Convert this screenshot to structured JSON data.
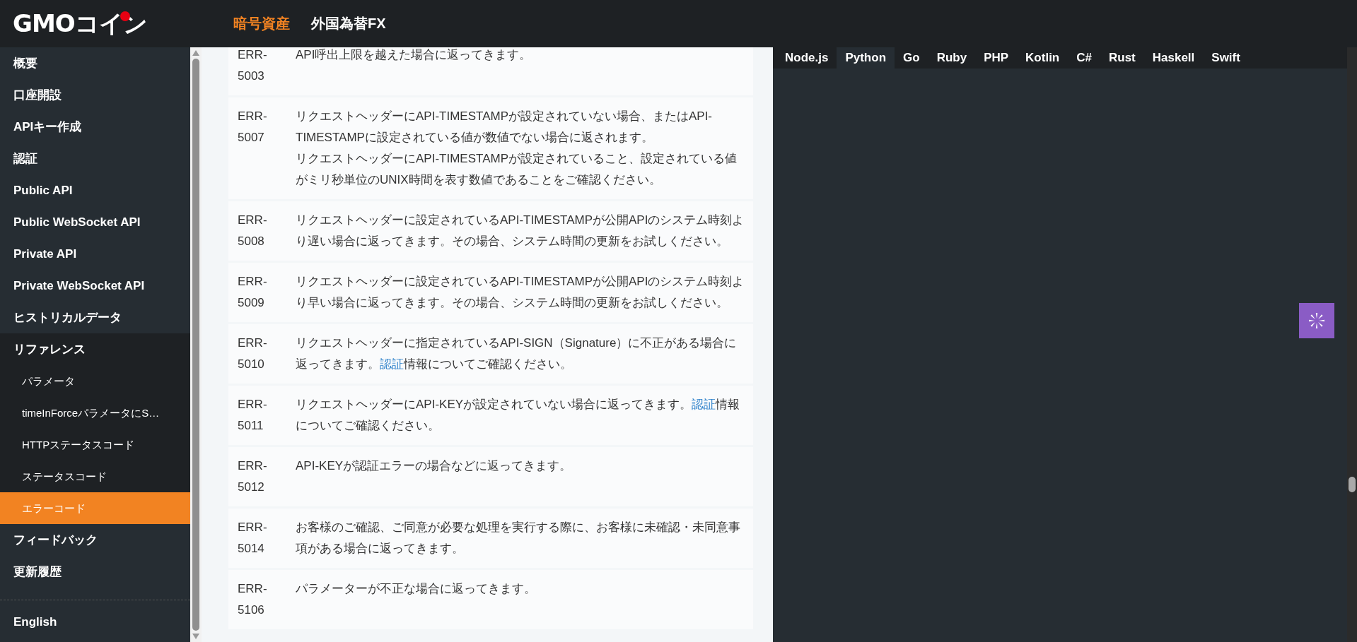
{
  "header": {
    "logo": "GMOコイン",
    "nav": [
      {
        "label": "暗号資産",
        "selected": true
      },
      {
        "label": "外国為替FX",
        "selected": false
      }
    ]
  },
  "sidebar": {
    "items": [
      {
        "label": "概要",
        "selected": false,
        "expanded": false
      },
      {
        "label": "口座開設",
        "selected": false,
        "expanded": false
      },
      {
        "label": "APIキー作成",
        "selected": false,
        "expanded": false
      },
      {
        "label": "認証",
        "selected": false,
        "expanded": false
      },
      {
        "label": "Public API",
        "selected": false,
        "expanded": false
      },
      {
        "label": "Public WebSocket API",
        "selected": false,
        "expanded": false
      },
      {
        "label": "Private API",
        "selected": false,
        "expanded": false
      },
      {
        "label": "Private WebSocket API",
        "selected": false,
        "expanded": false
      },
      {
        "label": "ヒストリカルデータ",
        "selected": false,
        "expanded": false
      },
      {
        "label": "リファレンス",
        "selected": false,
        "expanded": true,
        "children": [
          {
            "label": "パラメータ",
            "selected": false
          },
          {
            "label": "timeInForceパラメータにS…",
            "selected": false
          },
          {
            "label": "HTTPステータスコード",
            "selected": false
          },
          {
            "label": "ステータスコード",
            "selected": false
          },
          {
            "label": "エラーコード",
            "selected": true
          }
        ]
      },
      {
        "label": "フィードバック",
        "selected": false,
        "expanded": false
      },
      {
        "label": "更新履歴",
        "selected": false,
        "expanded": false
      }
    ],
    "language": "English"
  },
  "error_codes": [
    {
      "code": "ERR-5003",
      "paragraphs": [
        [
          {
            "text": "API呼出上限を越えた場合に返ってきます。",
            "link": false
          }
        ]
      ]
    },
    {
      "code": "ERR-5007",
      "paragraphs": [
        [
          {
            "text": "リクエストヘッダーにAPI-TIMESTAMPが設定されていない場合、またはAPI-TIMESTAMPに設定されている値が数値でない場合に返されます。",
            "link": false
          }
        ],
        [
          {
            "text": "リクエストヘッダーにAPI-TIMESTAMPが設定されていること、設定されている値がミリ秒単位のUNIX時間を表す数値であることをご確認ください。",
            "link": false
          }
        ]
      ]
    },
    {
      "code": "ERR-5008",
      "paragraphs": [
        [
          {
            "text": "リクエストヘッダーに設定されているAPI-TIMESTAMPが公開APIのシステム時刻より遅い場合に返ってきます。その場合、システム時間の更新をお試しください。",
            "link": false
          }
        ]
      ]
    },
    {
      "code": "ERR-5009",
      "paragraphs": [
        [
          {
            "text": "リクエストヘッダーに設定されているAPI-TIMESTAMPが公開APIのシステム時刻より早い場合に返ってきます。その場合、システム時間の更新をお試しください。",
            "link": false
          }
        ]
      ]
    },
    {
      "code": "ERR-5010",
      "paragraphs": [
        [
          {
            "text": "リクエストヘッダーに指定されているAPI-SIGN（Signature）に不正がある場合に返ってきます。",
            "link": false
          },
          {
            "text": "認証",
            "link": true
          },
          {
            "text": "情報についてご確認ください。",
            "link": false
          }
        ]
      ]
    },
    {
      "code": "ERR-5011",
      "paragraphs": [
        [
          {
            "text": "リクエストヘッダーにAPI-KEYが設定されていない場合に返ってきます。",
            "link": false
          },
          {
            "text": "認証",
            "link": true
          },
          {
            "text": "情報についてご確認ください。",
            "link": false
          }
        ]
      ]
    },
    {
      "code": "ERR-5012",
      "paragraphs": [
        [
          {
            "text": "API-KEYが認証エラーの場合などに返ってきます。",
            "link": false
          }
        ]
      ]
    },
    {
      "code": "ERR-5014",
      "paragraphs": [
        [
          {
            "text": "お客様のご確認、ご同意が必要な処理を実行する際に、お客様に未確認・未同意事項がある場合に返ってきます。",
            "link": false
          }
        ]
      ]
    },
    {
      "code": "ERR-5106",
      "paragraphs": [
        [
          {
            "text": "パラメーターが不正な場合に返ってきます。",
            "link": false
          }
        ]
      ]
    }
  ],
  "code_tabs": [
    {
      "label": "Node.js",
      "selected": false
    },
    {
      "label": "Python",
      "selected": true
    },
    {
      "label": "Go",
      "selected": false
    },
    {
      "label": "Ruby",
      "selected": false
    },
    {
      "label": "PHP",
      "selected": false
    },
    {
      "label": "Kotlin",
      "selected": false
    },
    {
      "label": "C#",
      "selected": false
    },
    {
      "label": "Rust",
      "selected": false
    },
    {
      "label": "Haskell",
      "selected": false
    },
    {
      "label": "Swift",
      "selected": false
    }
  ]
}
